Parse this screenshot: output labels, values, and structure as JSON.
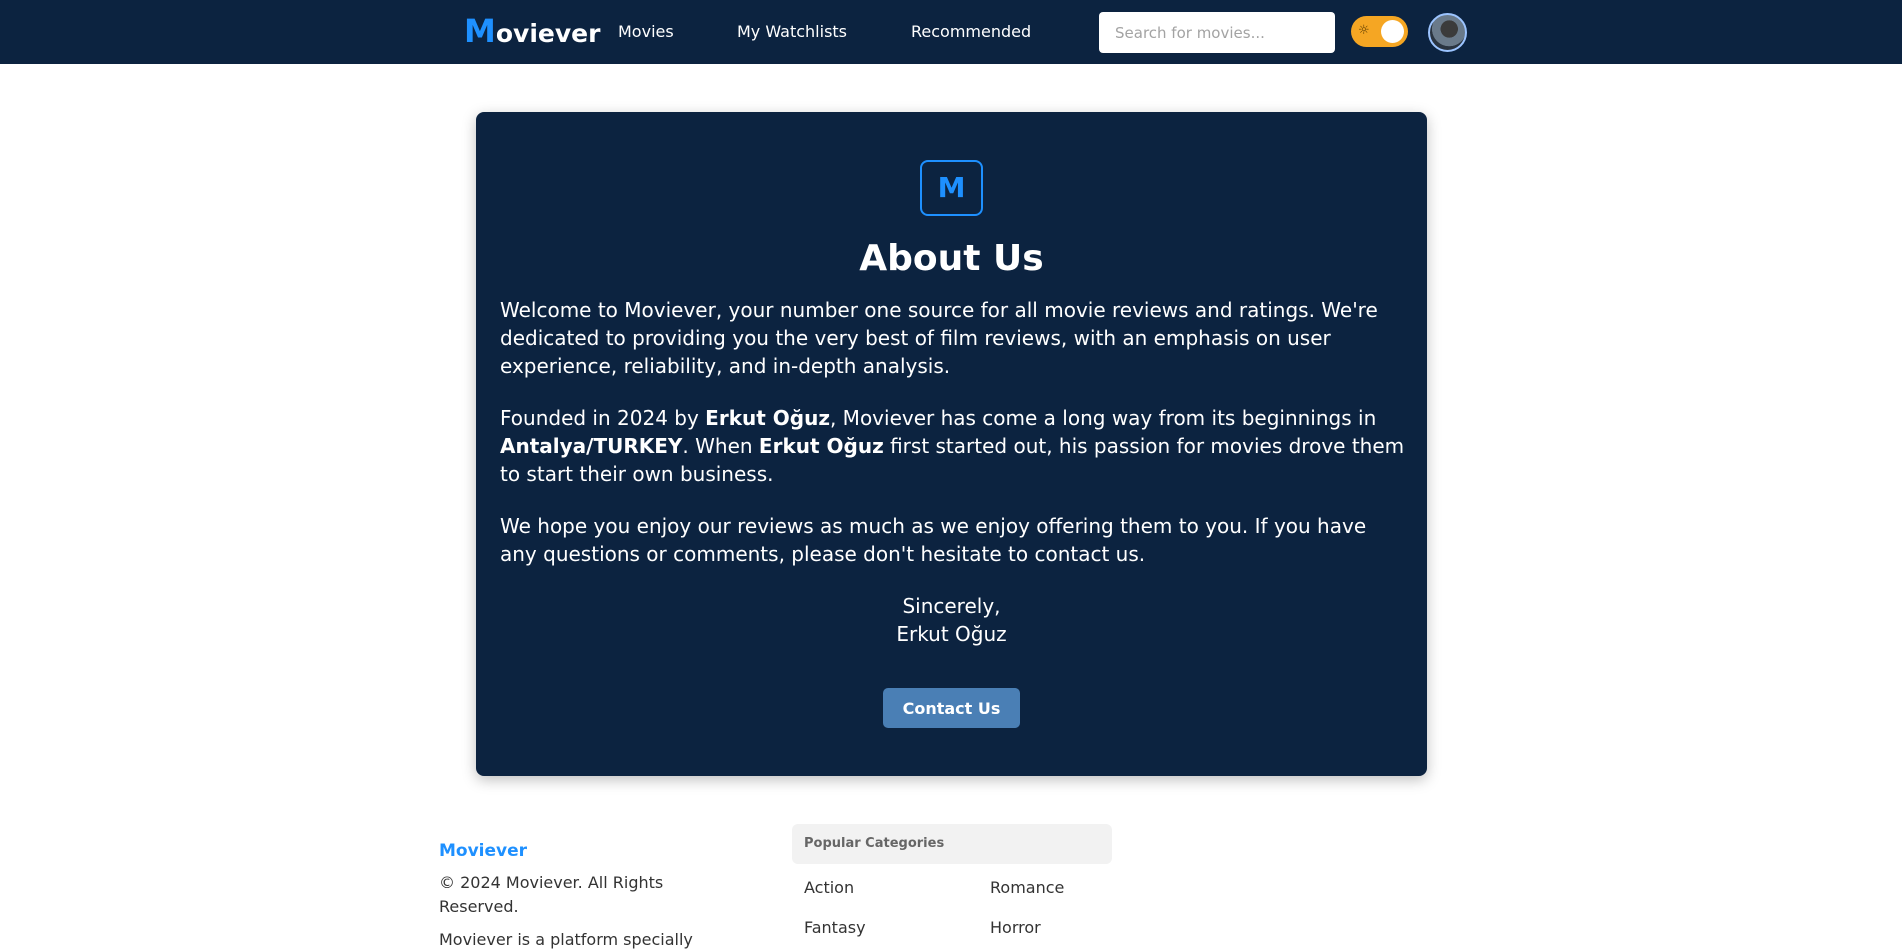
{
  "nav": {
    "logo_initial": "M",
    "logo_rest": "oviever",
    "links": [
      "Movies",
      "My Watchlists",
      "Recommended"
    ],
    "search_placeholder": "Search for movies...",
    "theme_toggle_icon": "sun-icon"
  },
  "about": {
    "badge": "M",
    "title": "About Us",
    "p1": "Welcome to Moviever, your number one source for all movie reviews and ratings. We're dedicated to providing you the very best of film reviews, with an emphasis on user experience, reliability, and in-depth analysis.",
    "p2_a": "Founded in 2024 by ",
    "p2_b": "Erkut Oğuz",
    "p2_c": ", Moviever has come a long way from its beginnings in ",
    "p2_d": "Antalya/TURKEY",
    "p2_e": ". When ",
    "p2_f": "Erkut Oğuz",
    "p2_g": " first started out, his passion for movies drove them to start their own business.",
    "p3": "We hope you enjoy our reviews as much as we enjoy offering them to you. If you have any questions or comments, please don't hesitate to contact us.",
    "sign_line1": "Sincerely,",
    "sign_line2": "Erkut Oğuz",
    "contact_button": "Contact Us"
  },
  "footer": {
    "brand": "Moviever",
    "copyright": "© 2024 Moviever. All Rights Reserved.",
    "description": "Moviever is a platform specially",
    "categories_header": "Popular Categories",
    "categories": [
      "Action",
      "Romance",
      "Fantasy",
      "Horror"
    ]
  },
  "colors": {
    "navy": "#0c2340",
    "accent_blue": "#1e90ff",
    "button_blue": "#4a7fb5",
    "toggle_orange": "#f5a623"
  }
}
